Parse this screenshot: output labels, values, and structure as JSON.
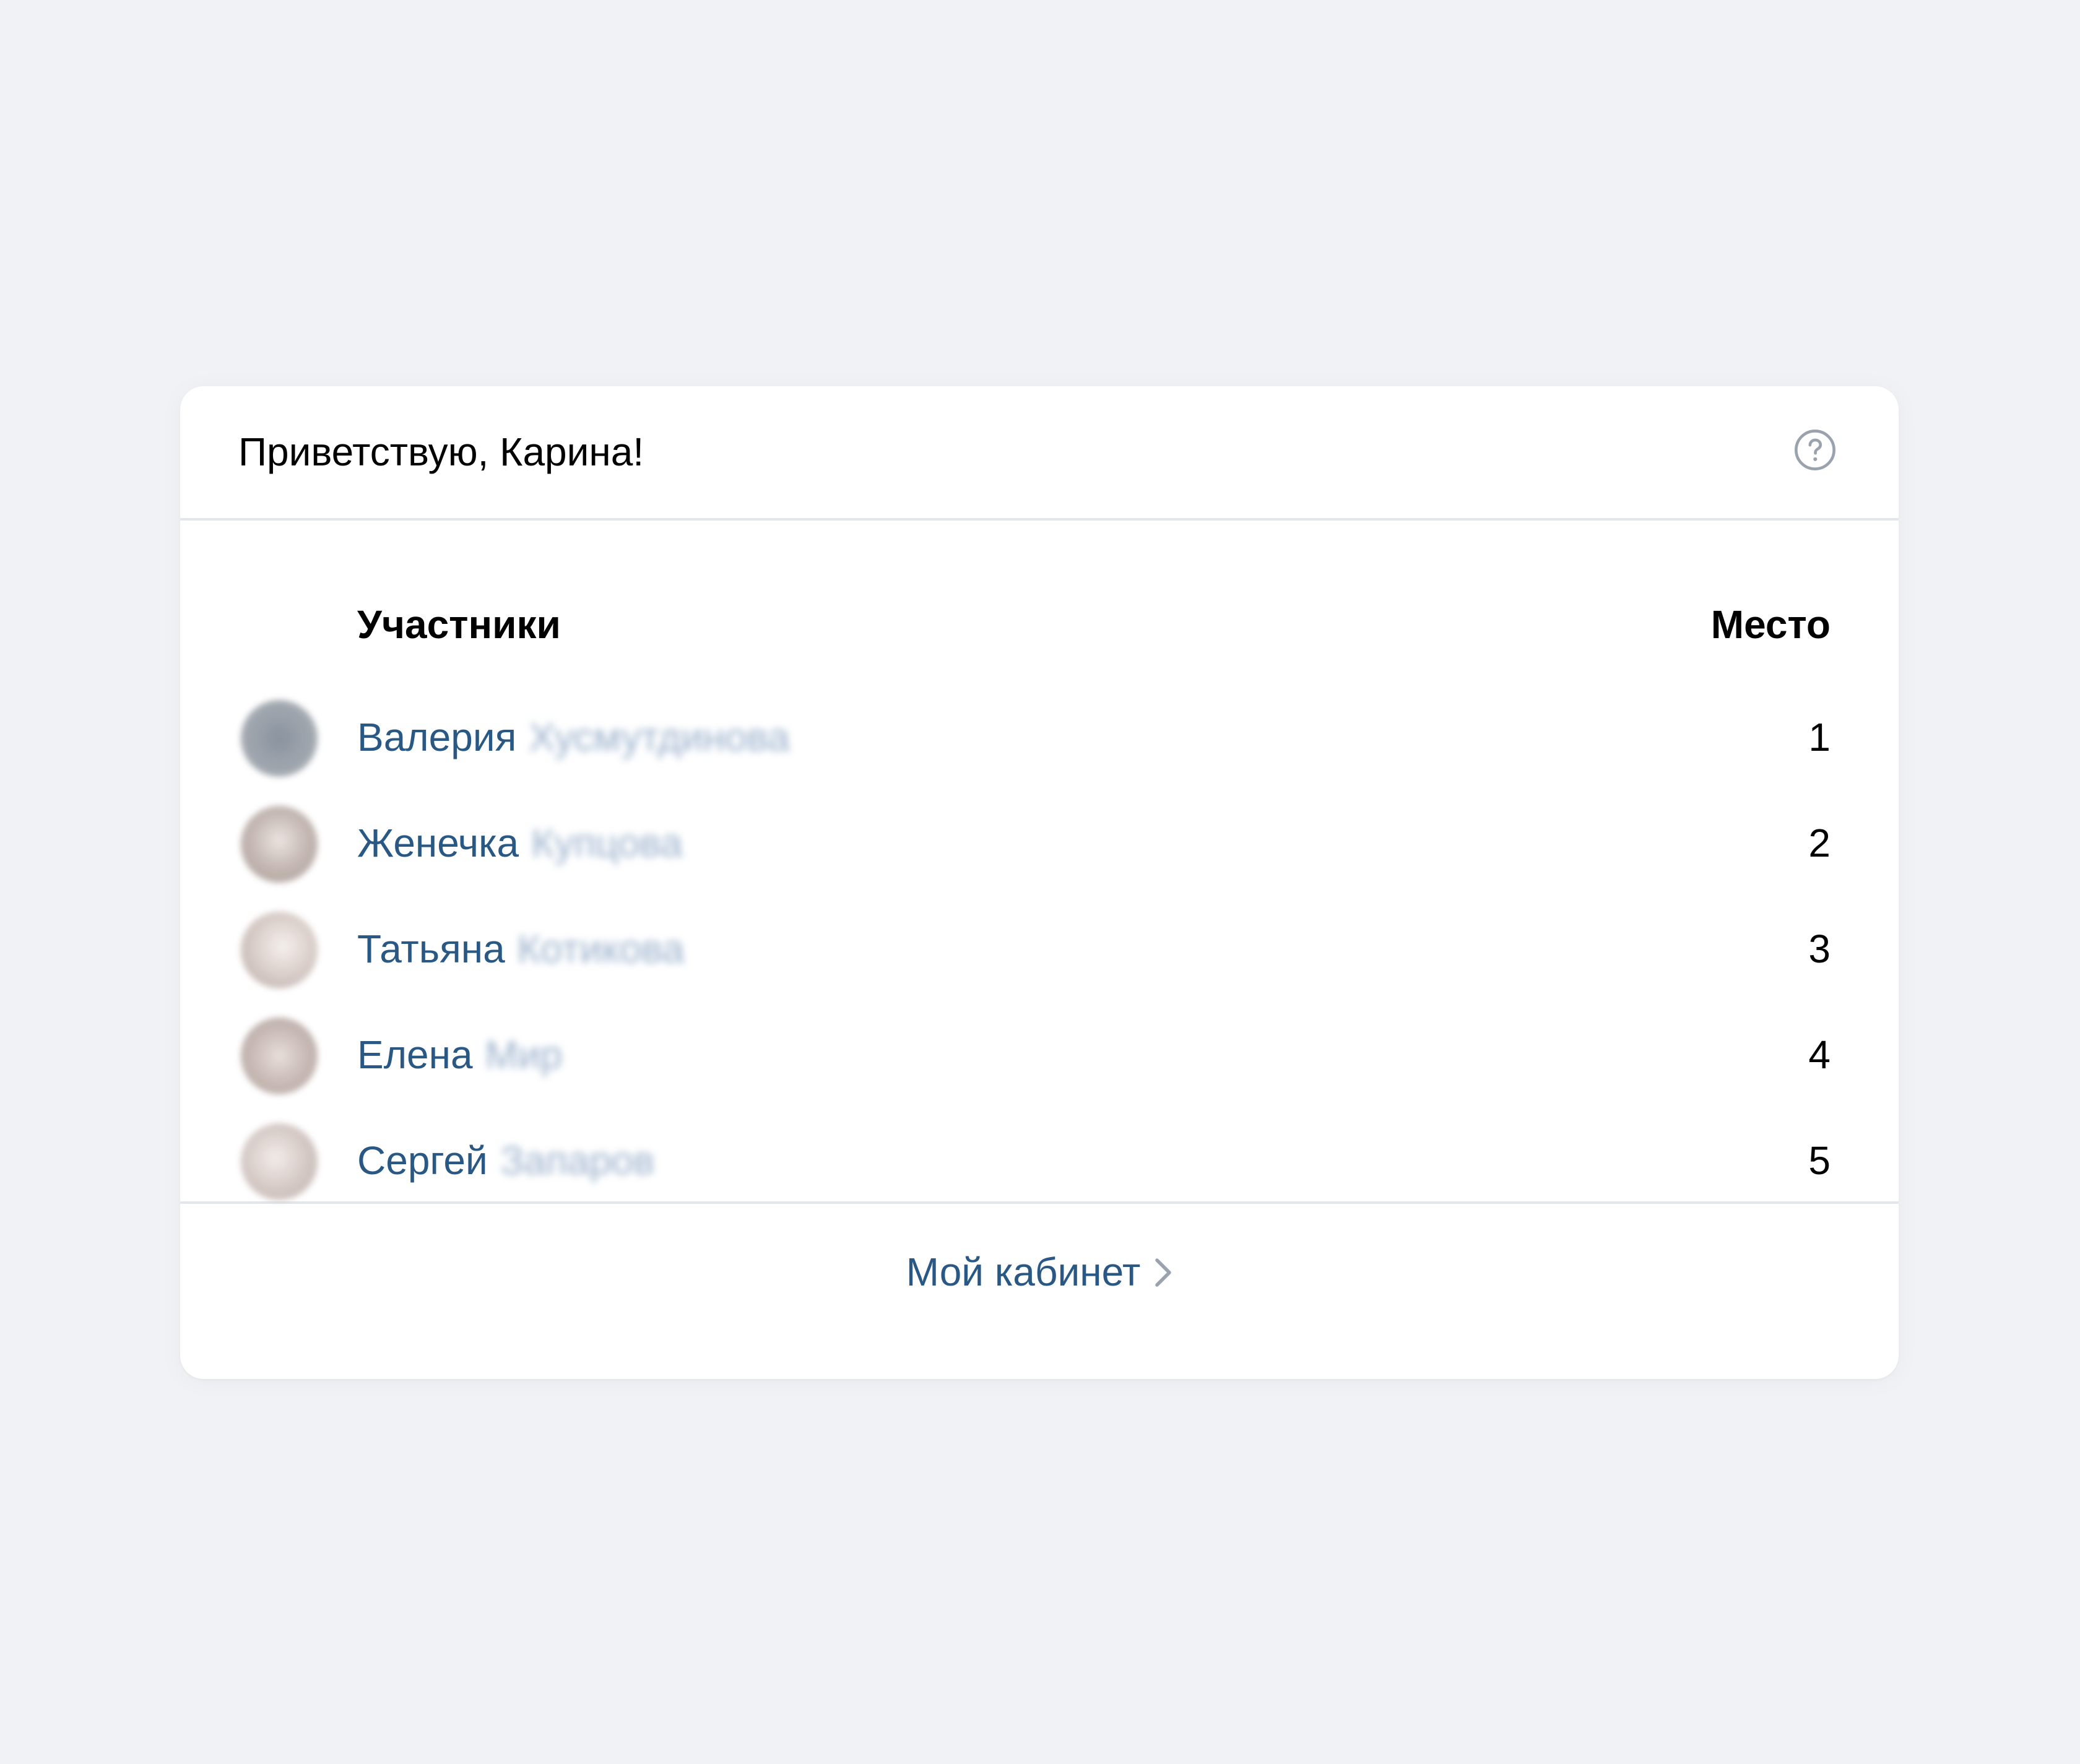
{
  "header": {
    "greeting": "Приветствую, Карина!",
    "help_icon": "question-circle-icon"
  },
  "table": {
    "columns": {
      "participants": "Участники",
      "place": "Место"
    },
    "rows": [
      {
        "first_name": "Валерия",
        "last_name": "Хусмутдинова",
        "place": "1",
        "avatar_color": "#8a9099"
      },
      {
        "first_name": "Женечка",
        "last_name": "Купцова",
        "place": "2",
        "avatar_color": "#b5a9a6"
      },
      {
        "first_name": "Татьяна",
        "last_name": "Котикова",
        "place": "3",
        "avatar_color": "#c9bdb8"
      },
      {
        "first_name": "Елена",
        "last_name": "Мир",
        "place": "4",
        "avatar_color": "#b8aaa5"
      },
      {
        "first_name": "Сергей",
        "last_name": "Запаров",
        "place": "5",
        "avatar_color": "#c4bab6"
      }
    ]
  },
  "footer": {
    "link_label": "Мой кабинет",
    "link_icon": "chevron-right-icon"
  },
  "colors": {
    "link": "#2a5885",
    "background": "#f0f2f5",
    "divider": "#e3e6ea",
    "icon": "#99a2ad"
  }
}
